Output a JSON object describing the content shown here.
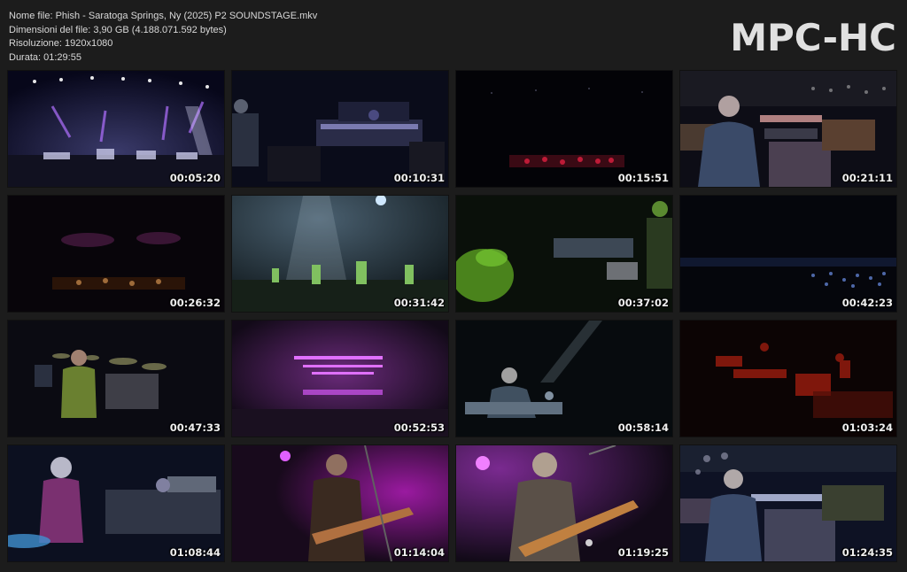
{
  "header": {
    "lines": [
      "Nome file: Phish - Saratoga Springs, Ny (2025) P2 SOUNDSTAGE.mkv",
      "Dimensioni del file: 3,90 GB (4.188.071.592 bytes)",
      "Risoluzione: 1920x1080",
      "Durata: 01:29:55"
    ],
    "brand": "MPC-HC"
  },
  "thumbnails": [
    {
      "time": "00:05:20",
      "scene": "wide-stage-lights-purple"
    },
    {
      "time": "00:10:31",
      "scene": "keyboard-rig-blue"
    },
    {
      "time": "00:15:51",
      "scene": "dark-stage-red-lights"
    },
    {
      "time": "00:21:11",
      "scene": "keyboardist-closeup"
    },
    {
      "time": "00:26:32",
      "scene": "dark-stage-amber"
    },
    {
      "time": "00:31:42",
      "scene": "stage-spotlights-green"
    },
    {
      "time": "00:37:02",
      "scene": "green-lit-equipment"
    },
    {
      "time": "00:42:23",
      "scene": "dark-crowd-blue"
    },
    {
      "time": "00:47:33",
      "scene": "drummer-kit"
    },
    {
      "time": "00:52:53",
      "scene": "stage-magenta-rig"
    },
    {
      "time": "00:58:14",
      "scene": "keyboardist-spotlight"
    },
    {
      "time": "01:03:24",
      "scene": "red-lit-stage"
    },
    {
      "time": "01:08:44",
      "scene": "drummer-purple"
    },
    {
      "time": "01:14:04",
      "scene": "guitarist-purple"
    },
    {
      "time": "01:19:25",
      "scene": "guitarist-closeup"
    },
    {
      "time": "01:24:35",
      "scene": "keyboardist-blue"
    }
  ]
}
